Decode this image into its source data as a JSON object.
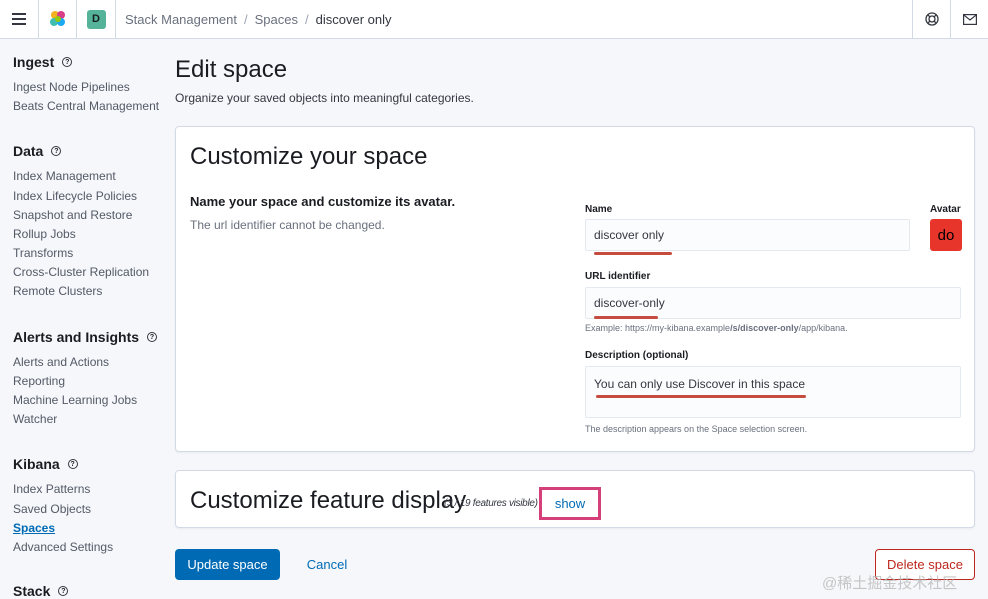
{
  "header": {
    "breadcrumbs": [
      "Stack Management",
      "Spaces",
      "discover only"
    ],
    "space_initial": "D",
    "space_color": "#54b399"
  },
  "sidebar": {
    "groups": [
      {
        "title": "Ingest",
        "items": [
          "Ingest Node Pipelines",
          "Beats Central Management"
        ]
      },
      {
        "title": "Data",
        "items": [
          "Index Management",
          "Index Lifecycle Policies",
          "Snapshot and Restore",
          "Rollup Jobs",
          "Transforms",
          "Cross-Cluster Replication",
          "Remote Clusters"
        ]
      },
      {
        "title": "Alerts and Insights",
        "items": [
          "Alerts and Actions",
          "Reporting",
          "Machine Learning Jobs",
          "Watcher"
        ]
      },
      {
        "title": "Kibana",
        "items": [
          "Index Patterns",
          "Saved Objects",
          "Spaces",
          "Advanced Settings"
        ]
      },
      {
        "title": "Stack",
        "items": []
      }
    ],
    "active_item": "Spaces"
  },
  "page": {
    "title": "Edit space",
    "description": "Organize your saved objects into meaningful categories."
  },
  "customize": {
    "title": "Customize your space",
    "section_title": "Name your space and customize its avatar.",
    "section_sub": "The url identifier cannot be changed.",
    "name_label": "Name",
    "name_value": "discover only",
    "avatar_label": "Avatar",
    "avatar_initials": "do",
    "avatar_color": "#e7352b",
    "url_label": "URL identifier",
    "url_value": "discover-only",
    "url_help_prefix": "Example: https://my-kibana.example",
    "url_help_bold": "/s/discover-only",
    "url_help_suffix": "/app/kibana.",
    "desc_label": "Description (optional)",
    "desc_value": "You can only use Discover in this space",
    "desc_help": "The description appears on the Space selection screen."
  },
  "features": {
    "title": "Customize feature display",
    "count": "(3 / 19 features visible)",
    "show_label": "show"
  },
  "actions": {
    "update_label": "Update space",
    "cancel_label": "Cancel",
    "delete_label": "Delete space"
  },
  "watermark": "@稀土掘金技术社区",
  "icons": {
    "menu": "hamburger-menu-icon",
    "logo": "elastic-logo-icon",
    "help": "help-icon",
    "newsfeed": "newsfeed-icon",
    "mail": "mail-icon"
  }
}
